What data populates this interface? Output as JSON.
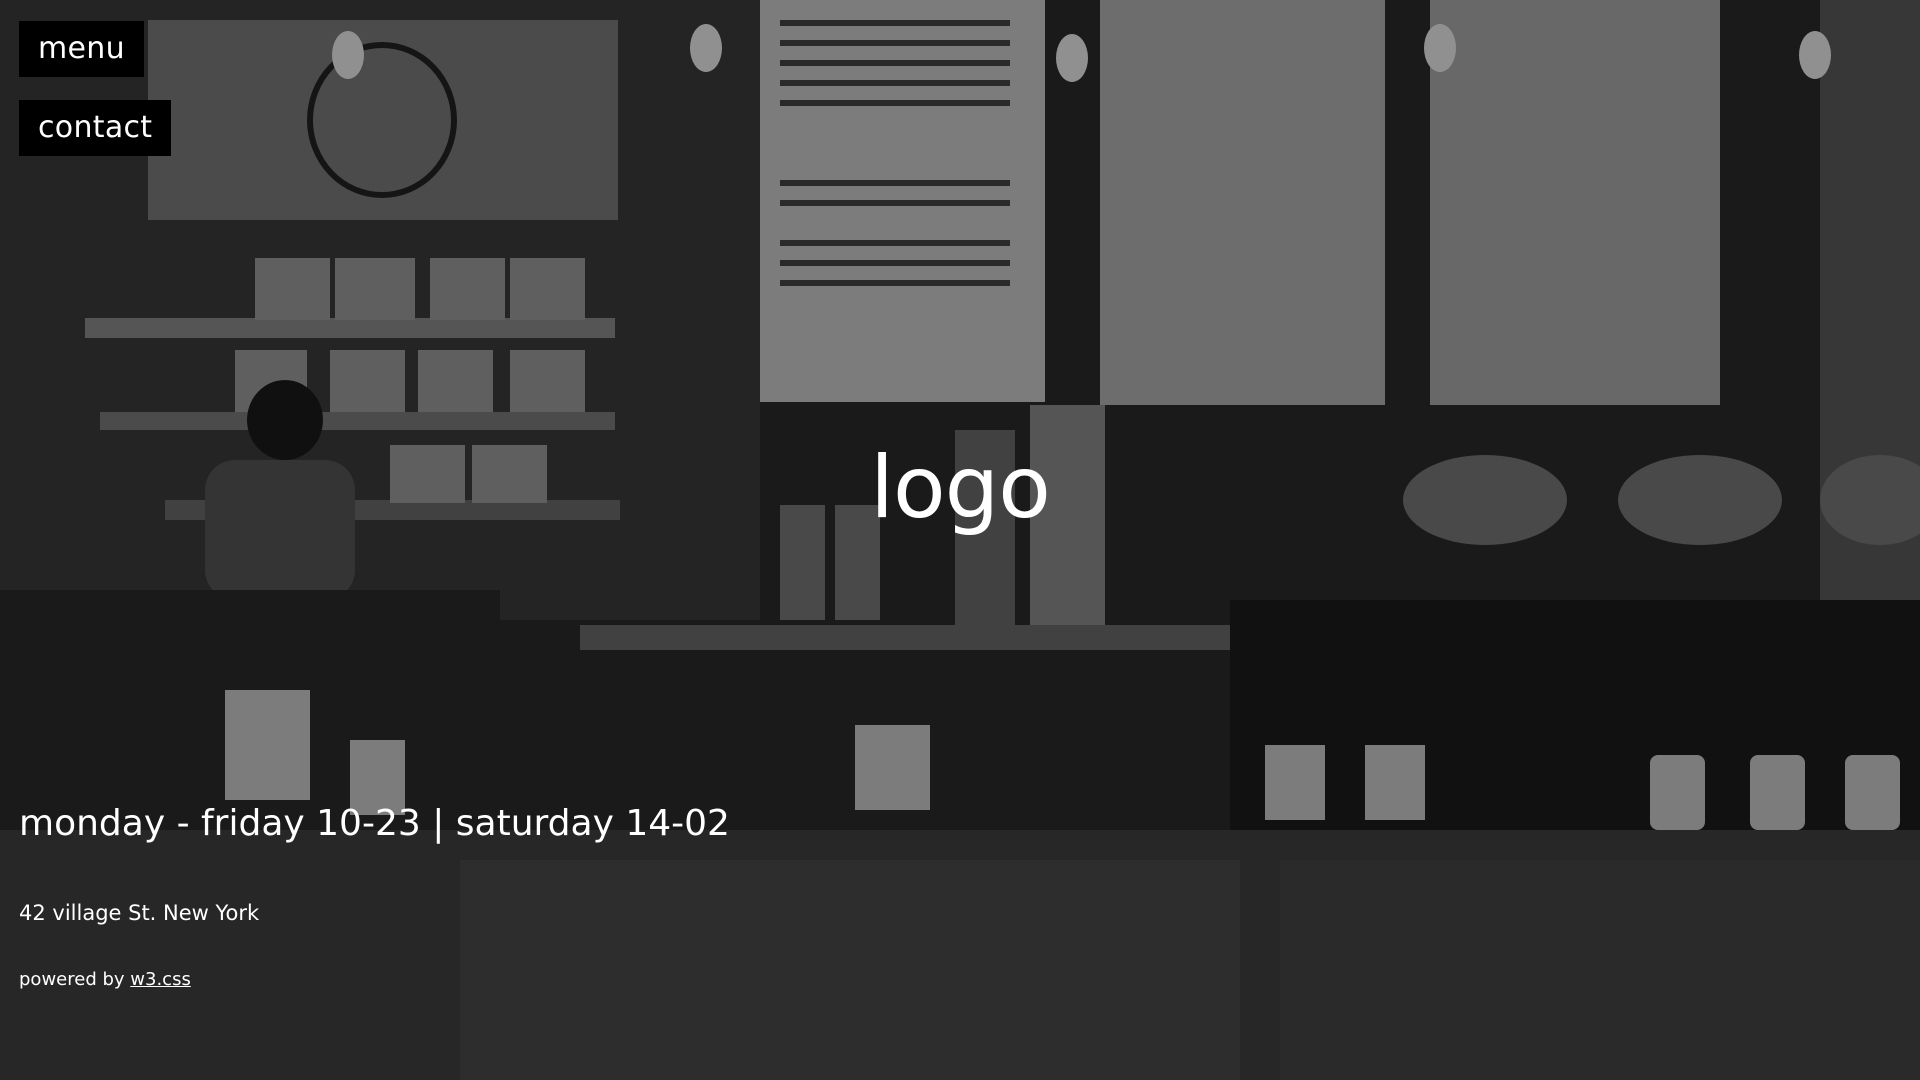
{
  "nav": {
    "menu_label": "menu",
    "contact_label": "contact"
  },
  "brand": {
    "logo_text": "logo"
  },
  "footer": {
    "hours": "monday - friday 10-23 | saturday 14-02",
    "address": "42 village St. New York",
    "powered_prefix": "powered by",
    "powered_link": "w3.css"
  },
  "colors": {
    "nav_background": "#000000",
    "text": "#ffffff"
  }
}
